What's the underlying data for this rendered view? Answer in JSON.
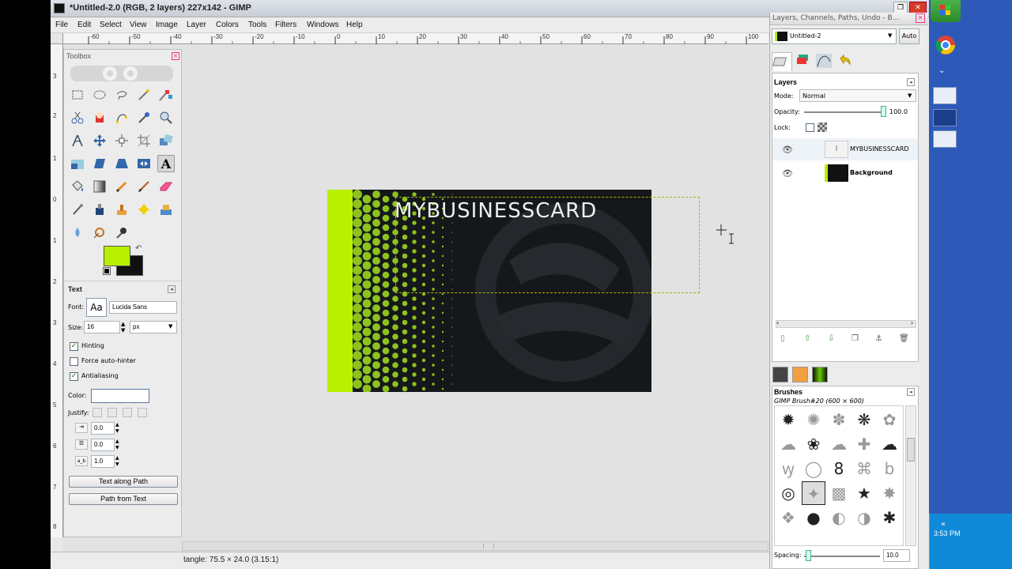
{
  "window": {
    "title": "*Untitled-2.0 (RGB, 2 layers) 227x142 - GIMP"
  },
  "menu": [
    "File",
    "Edit",
    "Select",
    "View",
    "Image",
    "Layer",
    "Colors",
    "Tools",
    "Filters",
    "Windows",
    "Help"
  ],
  "ruler": {
    "h_labels": [
      "-60",
      "-50",
      "-40",
      "-30",
      "-20",
      "-10",
      "0",
      "10",
      "20",
      "30",
      "40",
      "50",
      "60",
      "70",
      "80",
      "90",
      "100"
    ],
    "v_labels": [
      "3",
      "2",
      "1",
      "0",
      "1",
      "2",
      "3",
      "4",
      "5",
      "6",
      "7",
      "8"
    ]
  },
  "toolbox": {
    "title": "Toolbox",
    "fg_color": "#b8f000",
    "bg_color": "#111111",
    "text_options": {
      "title": "Text",
      "font_label": "Font:",
      "font_preview": "Aa",
      "font_value": "Lucida Sans",
      "size_label": "Size:",
      "size_value": "16",
      "unit": "px",
      "hinting": "Hinting",
      "force_autohinter": "Force auto-hinter",
      "antialiasing": "Antialiasing",
      "color_label": "Color:",
      "justify_label": "Justify:",
      "indent_value": "0.0",
      "line_spacing_value": "0.0",
      "letter_spacing_value": "1.0",
      "letter_icon": "a_b",
      "text_along_path": "Text along Path",
      "path_from_text": "Path from Text"
    }
  },
  "canvas": {
    "card_text": "MYBUSINESSCARD",
    "accent_color": "#b8f000"
  },
  "status": {
    "text": "tangle: 75.5 × 24.0 (3.15:1)"
  },
  "dock": {
    "title": "Layers, Channels, Paths, Undo - B...",
    "image_select": "Untitled-2",
    "auto_label": "Auto",
    "layers_title": "Layers",
    "mode_label": "Mode:",
    "mode_value": "Normal",
    "opacity_label": "Opacity:",
    "opacity_value": "100.0",
    "lock_label": "Lock:",
    "layers": [
      {
        "name": "MYBUSINESSCARD",
        "type": "text"
      },
      {
        "name": "Background",
        "type": "image"
      }
    ],
    "brushes_title": "Brushes",
    "brush_name": "GIMP Brush#20 (600 × 600)",
    "spacing_label": "Spacing:",
    "spacing_value": "10.0"
  },
  "taskbar": {
    "clock": "3:53 PM",
    "clock_suffix": "PM"
  }
}
